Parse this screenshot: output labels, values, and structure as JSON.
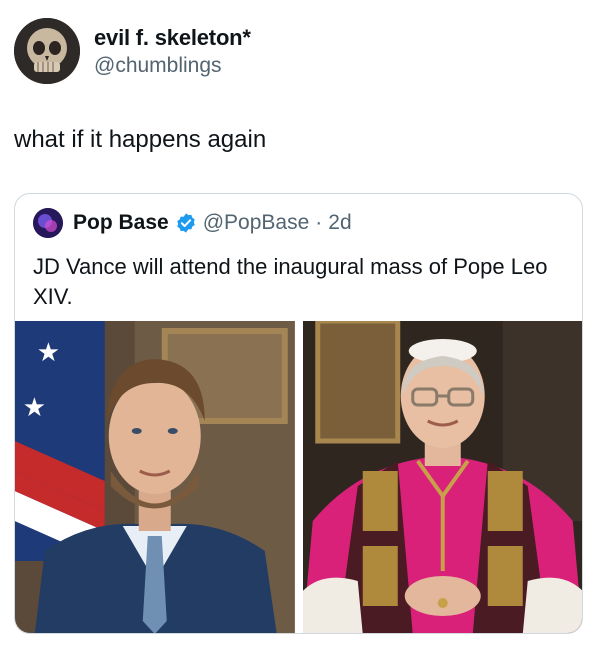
{
  "tweet": {
    "display_name": "evil f. skeleton*",
    "handle": "@chumblings",
    "text": "what if it happens again",
    "avatar_icon": "skull-avatar"
  },
  "quote": {
    "display_name": "Pop Base",
    "handle": "@PopBase",
    "separator": "·",
    "time": "2d",
    "text": "JD Vance will attend the inaugural mass of Pope Leo XIV.",
    "verified_icon": "verified-badge-icon",
    "verified_color": "#1d9bf0"
  },
  "media": [
    {
      "name": "photo-jd-vance",
      "icon": "portrait-photo"
    },
    {
      "name": "photo-pope-leo",
      "icon": "portrait-photo"
    }
  ],
  "colors": {
    "text": "#0f1419",
    "secondary_text": "#536471",
    "border": "#cfd9de",
    "vestment": "#d9217a"
  }
}
